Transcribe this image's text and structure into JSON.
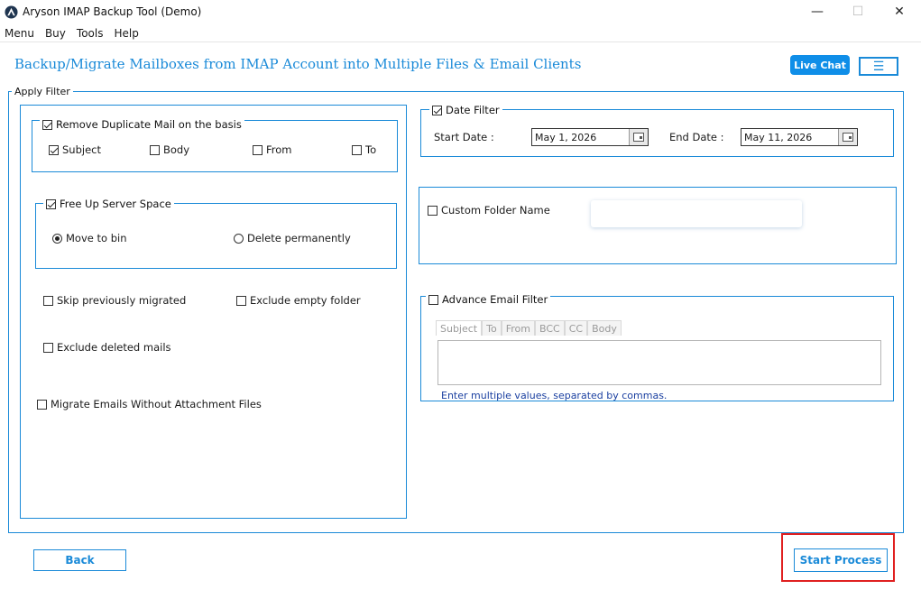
{
  "window": {
    "title": "Aryson IMAP Backup Tool (Demo)",
    "minimize": "—",
    "maximize": "☐",
    "close": "✕"
  },
  "menu": [
    "Menu",
    "Buy",
    "Tools",
    "Help"
  ],
  "header": {
    "title": "Backup/Migrate Mailboxes from IMAP Account into Multiple Files & Email Clients",
    "live_chat": "Live Chat",
    "hamburger": "☰"
  },
  "apply_filter": {
    "label": "Apply Filter",
    "duplicate": {
      "label": "Remove Duplicate Mail on the basis",
      "checked": true,
      "options": [
        {
          "label": "Subject",
          "checked": true
        },
        {
          "label": "Body",
          "checked": false
        },
        {
          "label": "From",
          "checked": false
        },
        {
          "label": "To",
          "checked": false
        }
      ]
    },
    "free_space": {
      "label": "Free Up Server Space",
      "checked": true,
      "move_to_bin": "Move to bin",
      "delete_permanently": "Delete permanently",
      "selected": "Move to bin"
    },
    "skip_migrated": "Skip previously migrated",
    "exclude_empty": "Exclude empty folder",
    "exclude_deleted": "Exclude deleted mails",
    "without_attachment": "Migrate Emails Without Attachment Files"
  },
  "date_filter": {
    "label": "Date Filter",
    "checked": true,
    "start_label": "Start Date :",
    "start_value": "May 1, 2026",
    "end_label": "End Date :",
    "end_value": "May 11, 2026"
  },
  "custom_folder": {
    "label": "Custom Folder Name",
    "checked": false,
    "value": ""
  },
  "advance_filter": {
    "label": "Advance Email Filter",
    "checked": false,
    "tabs": [
      "Subject",
      "To",
      "From",
      "BCC",
      "CC",
      "Body"
    ],
    "hint": "Enter multiple values, separated by commas."
  },
  "buttons": {
    "back": "Back",
    "start": "Start Process"
  },
  "colors": {
    "accent": "#1a8ad8",
    "live_chat_bg": "#0f8ee8",
    "highlight": "#e02020"
  }
}
